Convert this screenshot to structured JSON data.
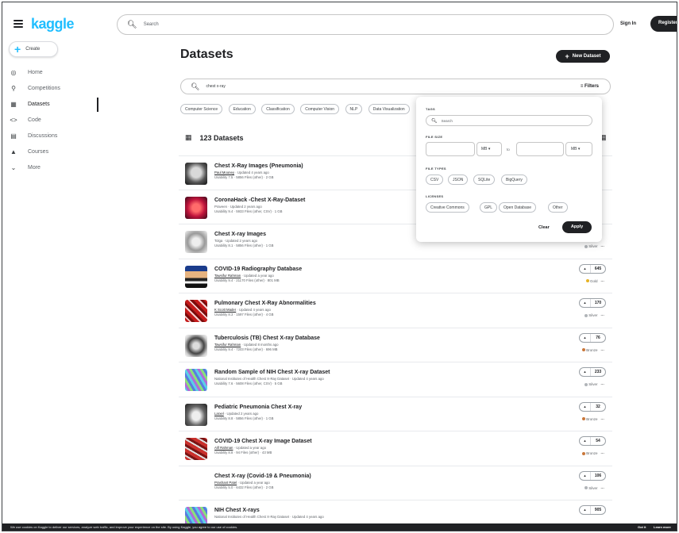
{
  "header": {
    "logo": "kaggle",
    "search_placeholder": "Search",
    "sign_in": "Sign In",
    "register": "Register"
  },
  "sidebar": {
    "create": "Create",
    "items": [
      {
        "label": "Home",
        "icon": "compass-icon"
      },
      {
        "label": "Competitions",
        "icon": "trophy-icon"
      },
      {
        "label": "Datasets",
        "icon": "table-icon"
      },
      {
        "label": "Code",
        "icon": "code-icon"
      },
      {
        "label": "Discussions",
        "icon": "comment-icon"
      },
      {
        "label": "Courses",
        "icon": "graduation-cap-icon"
      },
      {
        "label": "More",
        "icon": "chevron-down-icon"
      }
    ]
  },
  "main": {
    "title": "Datasets",
    "new_dataset": "New Dataset",
    "search_value": "chest x-ray",
    "filters": "Filters",
    "chips": [
      "Computer Science",
      "Education",
      "Classification",
      "Computer Vision",
      "NLP",
      "Data Visualization"
    ],
    "count": "123 Datasets"
  },
  "datasets": [
    {
      "title": "Chest X-Ray Images (Pneumonia)",
      "owner": "Paul Mooney",
      "updated": " · Updated 4 years ago",
      "usability": "Usability 7.5 · 5856 Files (other) · 2 GB",
      "votes": "",
      "medal": ""
    },
    {
      "title": "CoronaHack -Chest X-Ray-Dataset",
      "owner": "Praveen",
      "updated": " · Updated 2 years ago",
      "usability": "Usability 9.4 · 5933 Files (other, CSV) · 1 GB",
      "votes": "",
      "medal": ""
    },
    {
      "title": "Chest X-ray Images",
      "owner": "Tolga",
      "updated": " · Updated 2 years ago",
      "usability": "Usability 8.1 · 5856 Files (other) · 1 GB",
      "votes": "",
      "medal": "Silver"
    },
    {
      "title": "COVID-19 Radiography Database",
      "owner": "Tawsifur Rahman",
      "updated": " · Updated a year ago",
      "usability": "Usability 9.4 · 21170 Files (other) · 801 MB",
      "votes": "645",
      "medal": "Gold"
    },
    {
      "title": "Pulmonary Chest X-Ray Abnormalities",
      "owner": "K Scott Mader",
      "updated": " · Updated 4 years ago",
      "usability": "Usability 8.3 · 1597 Files (other) · 4 GB",
      "votes": "170",
      "medal": "Silver"
    },
    {
      "title": "Tuberculosis (TB) Chest X-ray Database",
      "owner": "Tawsifur Rahman",
      "updated": " · Updated 8 months ago",
      "usability": "Usability 9.4 · 7203 Files (other) · 696 MB",
      "votes": "76",
      "medal": "Bronze"
    },
    {
      "title": "Random Sample of NIH Chest X-ray Dataset",
      "owner": "National Institutes of Health Chest X-Ray Dataset",
      "updated": " · Updated 4 years ago",
      "usability": "Usability 7.6 · 5608 Files (other, CSV) · 5 GB",
      "votes": "233",
      "medal": "Silver"
    },
    {
      "title": "Pediatric Pneumonia Chest X-ray",
      "owner": "Larxel",
      "updated": " · Updated 2 years ago",
      "usability": "Usability 8.8 · 5856 Files (other) · 1 GB",
      "votes": "32",
      "medal": "Bronze"
    },
    {
      "title": "COVID-19 Chest X-ray Image Dataset",
      "owner": "Alif Rahman",
      "updated": " · Updated a year ago",
      "usability": "Usability 8.8 · 94 Files (other) · 43 MB",
      "votes": "54",
      "medal": "Bronze"
    },
    {
      "title": "Chest X-ray (Covid-19 & Pneumonia)",
      "owner": "Prashant Patel",
      "updated": " · Updated a year ago",
      "usability": "Usability 5.0 · 6432 Files (other) · 2 GB",
      "votes": "106",
      "medal": "Silver"
    },
    {
      "title": "NIH Chest X-rays",
      "owner": "National Institutes of Health Chest X-Ray Dataset",
      "updated": " · Updated 4 years ago",
      "usability": "",
      "votes": "905",
      "medal": ""
    }
  ],
  "filters_panel": {
    "tags_label": "TAGS",
    "tags_placeholder": "Search",
    "file_size_label": "FILE SIZE",
    "unit_min": "MB",
    "to": "to",
    "unit_max": "MB",
    "file_types_label": "FILE TYPES",
    "file_types": [
      "CSV",
      "JSON",
      "SQLite",
      "BigQuery"
    ],
    "licenses_label": "LICENSES",
    "licenses": [
      "Creative Commons",
      "GPL",
      "Open Database",
      "Other"
    ],
    "clear": "Clear",
    "apply": "Apply"
  },
  "cookie": {
    "message": "We use cookies on Kaggle to deliver our services, analyze web traffic, and improve your experience on the site. By using Kaggle, you agree to our use of cookies.",
    "got_it": "Got it",
    "learn_more": "Learn more"
  },
  "colors": {
    "brand": "#20beff",
    "dark": "#202124",
    "gold": "#e6b325",
    "silver": "#b0b4b8",
    "bronze": "#c9773a"
  }
}
